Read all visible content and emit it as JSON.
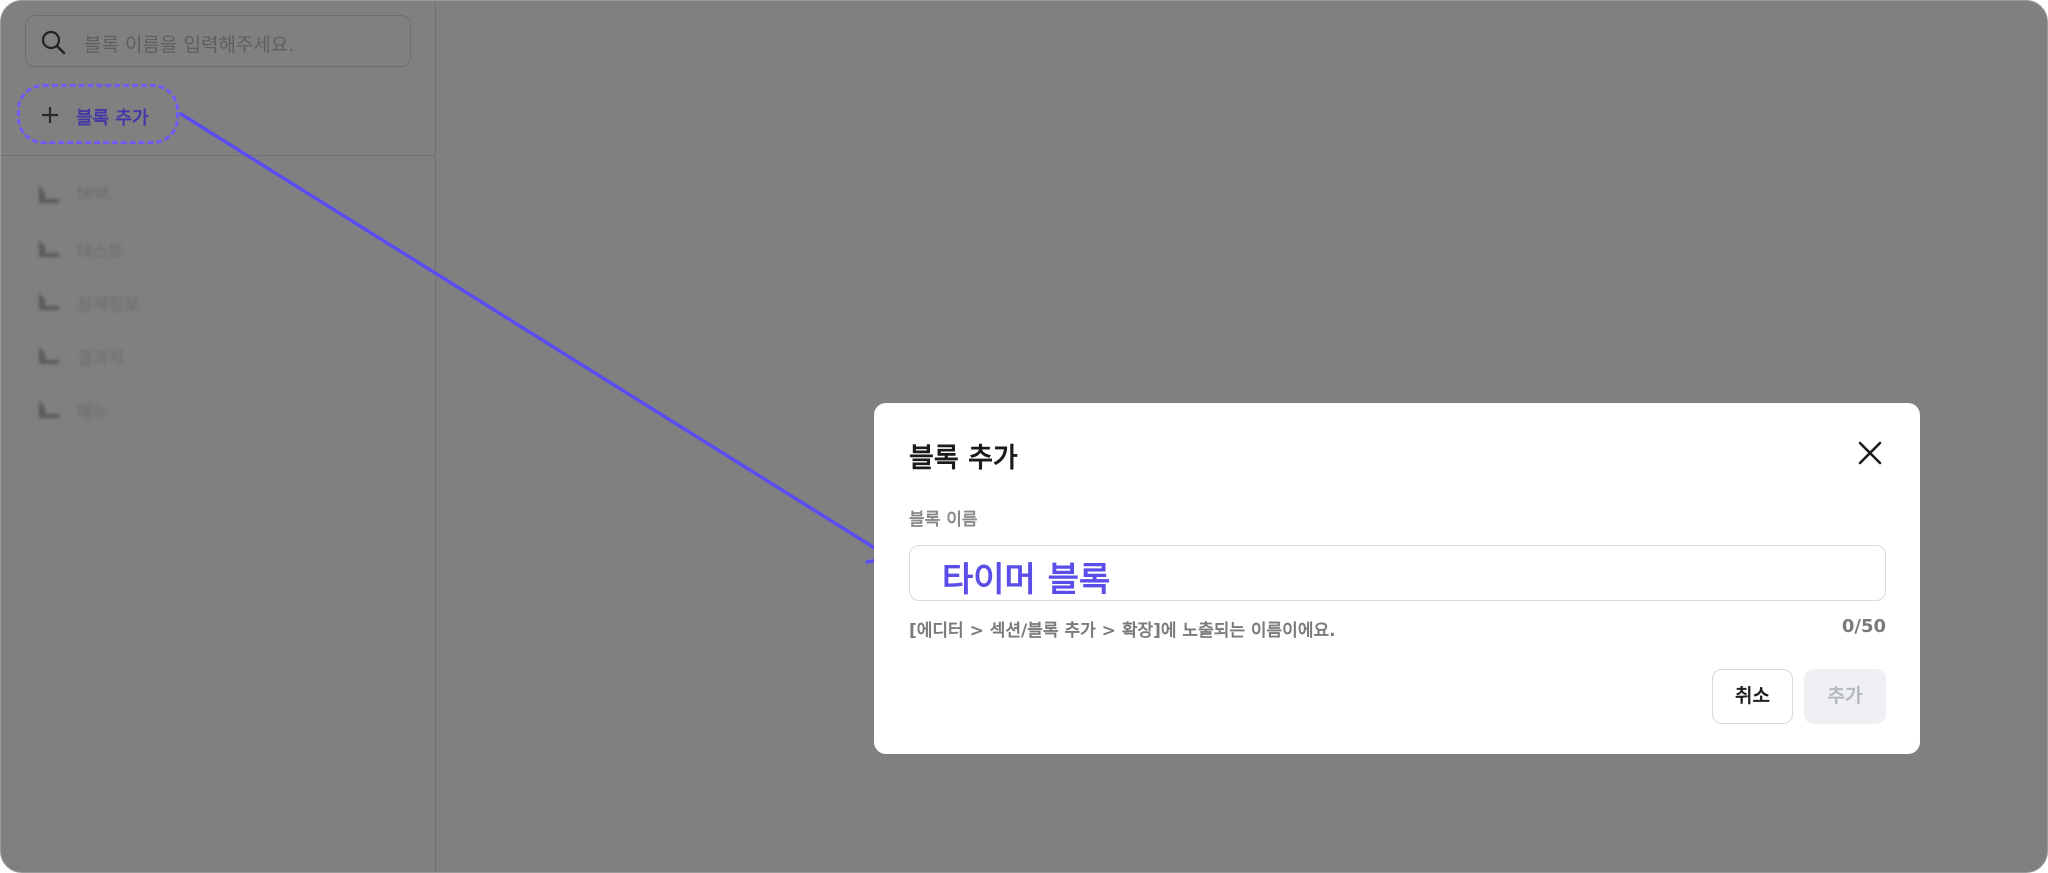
{
  "sidebar": {
    "search": {
      "placeholder": "블록 이름을 입력해주세요."
    },
    "add_block_label": "블록 추가",
    "items": [
      {
        "label": "test"
      },
      {
        "label": "테스트"
      },
      {
        "label": "상세정보"
      },
      {
        "label": "결과지"
      },
      {
        "label": "메뉴"
      }
    ]
  },
  "modal": {
    "title": "블록 추가",
    "field_label": "블록 이름",
    "input_value": "타이머 블록",
    "hint": "[에디터 > 섹션/블록 추가 > 확장]에 노출되는 이름이에요.",
    "counter": "0/50",
    "cancel_label": "취소",
    "add_label": "추가"
  },
  "colors": {
    "overlay": "#808080",
    "accent": "#5b4ee8",
    "annotation": "#6d5cf6"
  }
}
